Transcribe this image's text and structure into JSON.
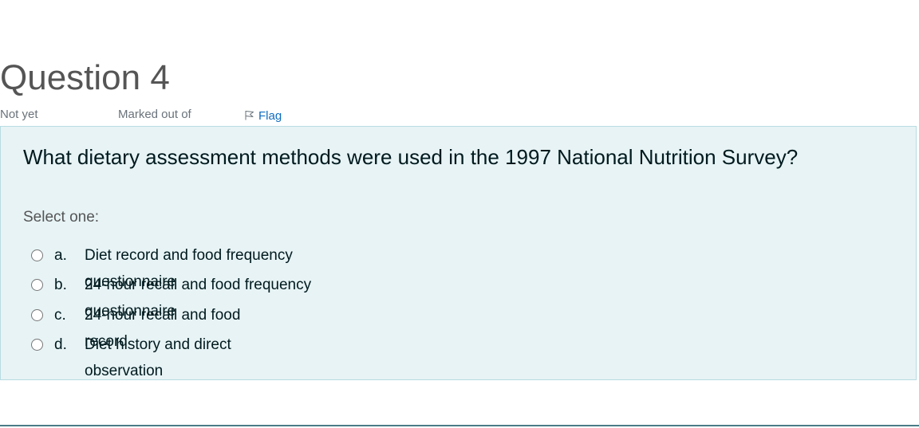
{
  "question": {
    "title": "Question 4",
    "status": "Not yet",
    "marks": "Marked out of",
    "flag_label": "Flag",
    "text": "What dietary assessment methods were used in the 1997 National Nutrition Survey?",
    "prompt": "Select one:",
    "answers": [
      {
        "num": "a.",
        "text": "Diet record and food frequency questionnaire"
      },
      {
        "num": "b.",
        "text": "24-hour recall and food frequency questionnaire"
      },
      {
        "num": "c.",
        "text": "24-hour recall and food record"
      },
      {
        "num": "d.",
        "text": "Diet history and direct observation"
      }
    ]
  },
  "colors": {
    "content_bg": "#e7f3f5",
    "content_border": "#b8dce2",
    "link": "#0f6cbf",
    "bottom_rule": "#4a7c86"
  },
  "icons": {
    "flag": "flag-icon"
  }
}
